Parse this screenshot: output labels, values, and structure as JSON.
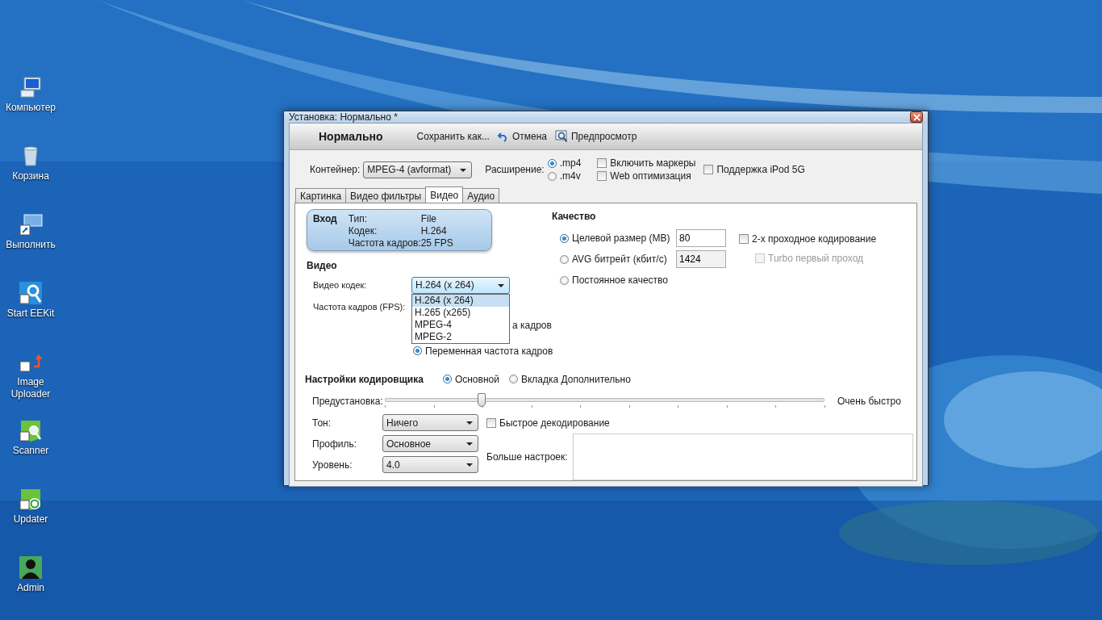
{
  "desktop_icons": [
    {
      "label": "Компьютер",
      "kind": "computer"
    },
    {
      "label": "Корзина",
      "kind": "bin"
    },
    {
      "label": "Выполнить",
      "kind": "run"
    },
    {
      "label": "Start EEKit",
      "kind": "magnifier"
    },
    {
      "label": "Image Uploader",
      "kind": "uploader"
    },
    {
      "label": "Scanner",
      "kind": "scanner"
    },
    {
      "label": "Updater",
      "kind": "updater"
    },
    {
      "label": "Admin",
      "kind": "user"
    }
  ],
  "window": {
    "title": "Установка: Нормально *"
  },
  "toolbar": {
    "preset_name": "Нормально",
    "buttons": [
      {
        "label": "Сохранить как...",
        "kind": "text"
      },
      {
        "label": "Отмена",
        "kind": "undo"
      },
      {
        "label": "Предпросмотр",
        "kind": "preview"
      }
    ]
  },
  "container": {
    "label": "Контейнер:",
    "value": "MPEG-4 (avformat)"
  },
  "extension": {
    "label": "Расширение:",
    "options": [
      {
        "label": ".mp4",
        "selected": true
      },
      {
        "label": ".m4v",
        "selected": false
      }
    ]
  },
  "options": [
    {
      "label": "Включить маркеры",
      "checked": false
    },
    {
      "label": "Web оптимизация",
      "checked": false
    },
    {
      "label": "Поддержка iPod 5G",
      "checked": false
    }
  ],
  "tabs": [
    {
      "label": "Картинка",
      "selected": false
    },
    {
      "label": "Видео фильтры",
      "selected": false
    },
    {
      "label": "Видео",
      "selected": true
    },
    {
      "label": "Аудио",
      "selected": false
    }
  ],
  "source": {
    "heading": "Вход",
    "rows": [
      {
        "label": "Тип:",
        "value": "File"
      },
      {
        "label": "Кодек:",
        "value": "H.264"
      },
      {
        "label": "Частота кадров:",
        "value": "25  FPS"
      }
    ]
  },
  "video": {
    "heading": "Видео",
    "codec_label": "Видео кодек:",
    "codec_value": "H.264 (x 264)",
    "codec_options": [
      {
        "label": "H.264 (x 264)",
        "selected": true
      },
      {
        "label": "H.265 (x265)",
        "selected": false
      },
      {
        "label": "MPEG-4",
        "selected": false
      },
      {
        "label": "MPEG-2",
        "selected": false
      }
    ],
    "fps_label": "Частота кадров (FPS):",
    "fps_modes": [
      {
        "label": "а кадров"
      },
      {
        "label": "Переменная частота кадров",
        "selected": true
      }
    ]
  },
  "quality": {
    "heading": "Качество",
    "modes": [
      {
        "label": "Целевой размер (MB)",
        "selected": true,
        "value": "80",
        "disabled": false
      },
      {
        "label": "AVG битрейт (кбит/с)",
        "selected": false,
        "value": "1424",
        "disabled": true
      },
      {
        "label": "Постоянное качество",
        "selected": false
      }
    ],
    "two_pass": {
      "label": "2-х проходное кодирование",
      "checked": false
    },
    "turbo": {
      "label": "Turbo первый проход",
      "checked": false,
      "disabled": true
    }
  },
  "encoder": {
    "heading": "Настройки кодировщика",
    "modes": [
      {
        "label": "Основной",
        "selected": true
      },
      {
        "label": "Вкладка Дополнительно",
        "selected": false
      }
    ],
    "preset": {
      "label": "Предустановка:",
      "level": 0.22,
      "reading": "Очень быстро"
    },
    "fields": [
      {
        "label": "Тон:",
        "value": "Ничего"
      },
      {
        "label": "Профиль:",
        "value": "Основное"
      },
      {
        "label": "Уровень:",
        "value": "4.0"
      }
    ],
    "fast_decode": {
      "label": "Быстрое декодирование",
      "checked": false
    },
    "more_label": "Больше настроек:"
  }
}
